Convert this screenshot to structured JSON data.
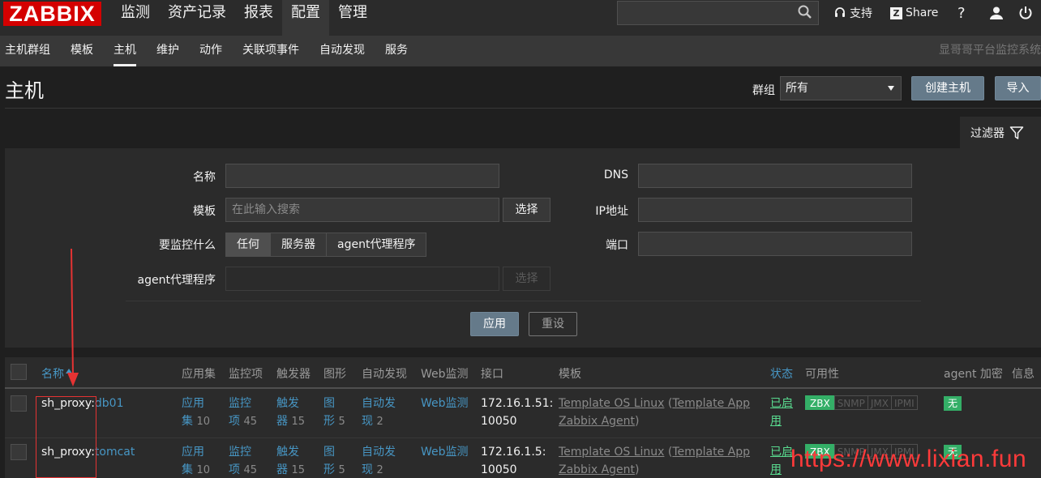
{
  "brand": {
    "logo": "ZABBIX"
  },
  "main_menu": [
    "监测",
    "资产记录",
    "报表",
    "配置",
    "管理"
  ],
  "top_right": {
    "support": "支持",
    "share": "Share",
    "help": "?"
  },
  "sub_menu": [
    "主机群组",
    "模板",
    "主机",
    "维护",
    "动作",
    "关联项事件",
    "自动发现",
    "服务"
  ],
  "sub_brand": "显哥哥平台监控系统",
  "page": {
    "title": "主机",
    "group_label": "群组",
    "group_value": "所有",
    "create_button": "创建主机",
    "import_button": "导入"
  },
  "filter": {
    "tab": "过滤器",
    "name_label": "名称",
    "template_label": "模板",
    "template_placeholder": "在此输入搜索",
    "select_label": "选择",
    "monitored_by_label": "要监控什么",
    "monitored_by_options": [
      "任何",
      "服务器",
      "agent代理程序"
    ],
    "proxy_label": "agent代理程序",
    "proxy_select": "选择",
    "dns_label": "DNS",
    "ip_label": "IP地址",
    "port_label": "端口",
    "apply": "应用",
    "reset": "重设"
  },
  "table": {
    "headers": {
      "name": "名称",
      "applications": "应用集",
      "items": "监控项",
      "triggers": "触发器",
      "graphs": "图形",
      "discovery": "自动发现",
      "web": "Web监测",
      "interface": "接口",
      "templates": "模板",
      "status": "状态",
      "availability": "可用性",
      "agent_encryption": "agent 加密",
      "info": "信息"
    },
    "rows": [
      {
        "proxy": "sh_proxy:",
        "host": "db01",
        "app_a": "应用",
        "app_b": "集",
        "app_n": "10",
        "item_a": "监控",
        "item_b": "项",
        "item_n": "45",
        "trig_a": "触发",
        "trig_b": "器",
        "trig_n": "15",
        "graph_a": "图",
        "graph_b": "形",
        "graph_n": "5",
        "disc_a": "自动发",
        "disc_b": "现",
        "disc_n": "2",
        "web": "Web监测",
        "iface_a": "172.16.1.51:",
        "iface_b": "10050",
        "tmpl_1": "Template OS Linux",
        "tmpl_paren": " (",
        "tmpl_2a": "Template App",
        "tmpl_2b": "Zabbix Agent",
        "tmpl_close": ")",
        "status_a": "已启",
        "status_b": "用",
        "avail": [
          "ZBX",
          "SNMP",
          "JMX",
          "IPMI"
        ],
        "encryption": "无"
      },
      {
        "proxy": "sh_proxy:",
        "host": "tomcat",
        "app_a": "应用",
        "app_b": "集",
        "app_n": "10",
        "item_a": "监控",
        "item_b": "项",
        "item_n": "45",
        "trig_a": "触发",
        "trig_b": "器",
        "trig_n": "15",
        "graph_a": "图",
        "graph_b": "形",
        "graph_n": "5",
        "disc_a": "自动发",
        "disc_b": "现",
        "disc_n": "2",
        "web": "Web监测",
        "iface_a": "172.16.1.5:",
        "iface_b": "10050",
        "tmpl_1": "Template OS Linux",
        "tmpl_paren": " (",
        "tmpl_2a": "Template App",
        "tmpl_2b": "Zabbix Agent",
        "tmpl_close": ")",
        "status_a": "已启",
        "status_b": "用",
        "avail": [
          "ZBX",
          "SNMP",
          "JMX",
          "IPMI"
        ],
        "encryption": "无"
      }
    ]
  },
  "watermark": "https://www.lixian.fun",
  "colors": {
    "logo_red": "#d40000",
    "link_blue": "#4796c4",
    "green": "#34af67",
    "annotation_red": "#e53333"
  }
}
